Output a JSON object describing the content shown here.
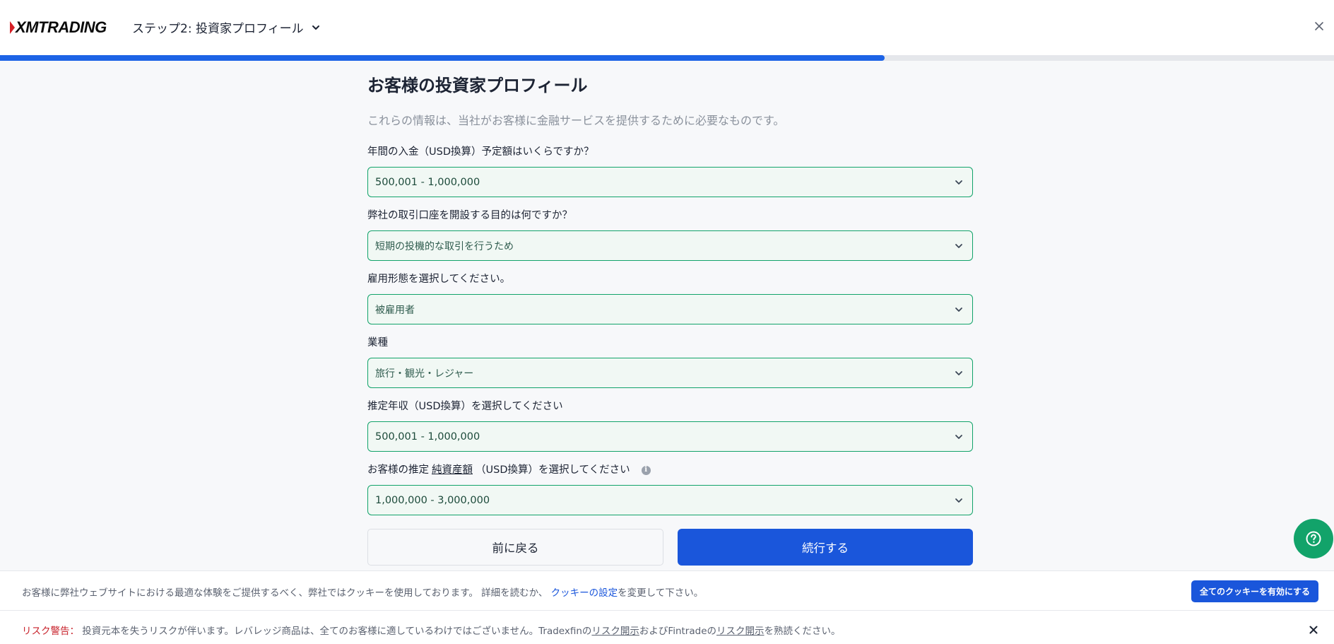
{
  "header": {
    "logo_text": "XMTRADING",
    "step_label": "ステップ2: 投資家プロフィール",
    "progress_fraction": 0.663
  },
  "main": {
    "title": "お客様の投資家プロフィール",
    "subtitle": "これらの情報は、当社がお客様に金融サービスを提供するために必要なものです。",
    "fields": [
      {
        "label": "年間の入金（USD換算）予定額はいくらですか？",
        "value": "500,001 - 1,000,000"
      },
      {
        "label": "弊社の取引口座を開設する目的は何ですか？",
        "value": "短期の投機的な取引を行うため"
      },
      {
        "label": "雇用形態を選択してください。",
        "value": "被雇用者"
      },
      {
        "label": "業種",
        "value": "旅行・観光・レジャー"
      },
      {
        "label": "推定年収（USD換算）を選択してください",
        "value": "500,001 - 1,000,000"
      },
      {
        "label_prefix": "お客様の推定",
        "label_underlined": "純資産額",
        "label_suffix": "（USD換算）を選択してください",
        "value": "1,000,000 - 3,000,000"
      }
    ],
    "back_label": "前に戻る",
    "continue_label": "続行する"
  },
  "cookie": {
    "text": "お客様に弊社ウェブサイトにおける最適な体験をご提供するべく、弊社ではクッキーを使用しております。 詳細を読むか、",
    "link": "クッキーの設定",
    "text_after": "を変更して下さい。",
    "button_label": "全てのクッキーを有効にする"
  },
  "risk": {
    "label": "リスク警告：",
    "text1": "投資元本を失うリスクが伴います。レバレッジ商品は、全てのお客様に適しているわけではございません。Tradexfinの",
    "link1": "リスク開示",
    "text2": "およびFintradeの",
    "link2": "リスク開示",
    "text3": "を熟読ください。"
  },
  "colors": {
    "accent_blue": "#1a56db",
    "accent_green": "#12a36a",
    "warning_red": "#c8232c"
  }
}
